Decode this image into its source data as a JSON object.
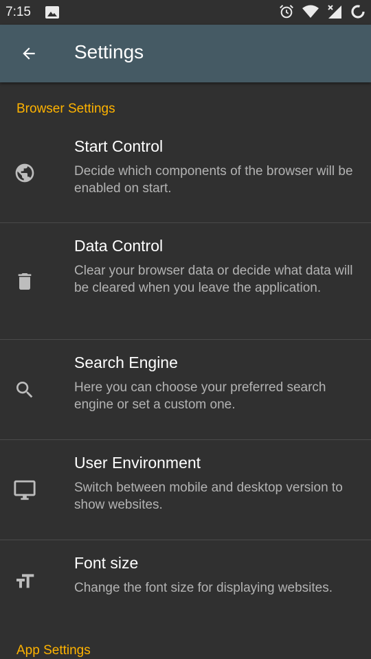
{
  "status_bar": {
    "time": "7:15"
  },
  "app_bar": {
    "title": "Settings"
  },
  "sections": {
    "browser": "Browser Settings",
    "app": "App Settings"
  },
  "preferences": [
    {
      "title": "Start Control",
      "summary": "Decide which components of the browser will be enabled on start.",
      "icon": "globe-icon"
    },
    {
      "title": "Data Control",
      "summary": "Clear your browser data or decide what data will be cleared when you leave the application.",
      "icon": "trash-icon"
    },
    {
      "title": "Search Engine",
      "summary": "Here you can choose your preferred search engine or set a custom one.",
      "icon": "search-icon"
    },
    {
      "title": "User Environment",
      "summary": "Switch between mobile and desktop version to show websites.",
      "icon": "desktop-monitor-icon"
    },
    {
      "title": "Font size",
      "summary": "Change the font size for displaying websites.",
      "icon": "text-size-icon"
    }
  ],
  "colors": {
    "app_bar": "#455a64",
    "background": "#303030",
    "accent": "#ffb300"
  }
}
